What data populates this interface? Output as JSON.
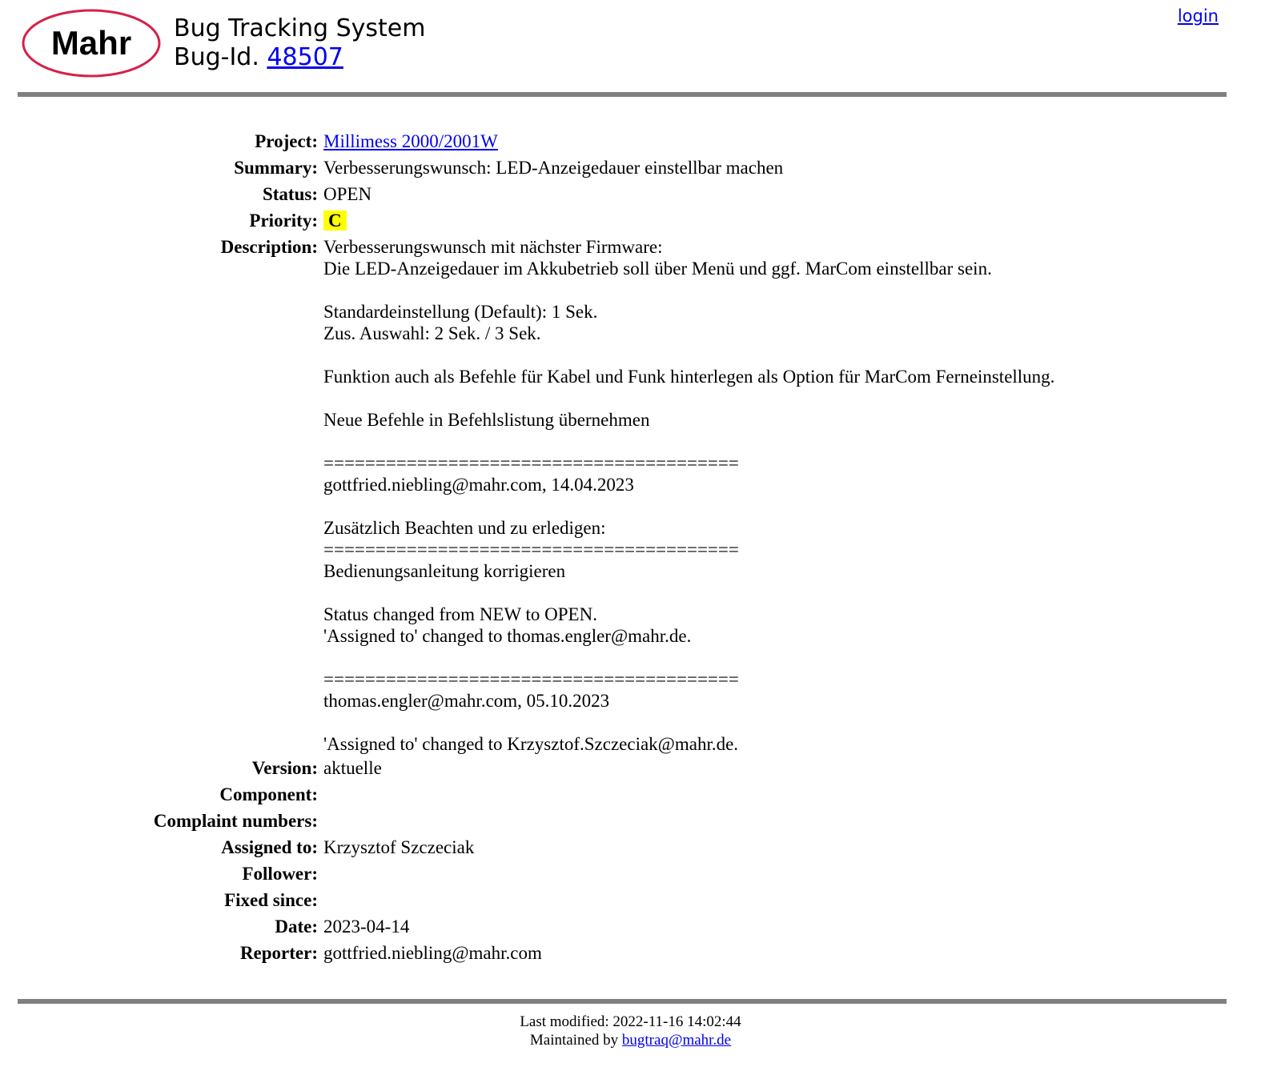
{
  "header": {
    "logo_text": "Mahr",
    "title": "Bug Tracking System",
    "bug_id_prefix": "Bug-Id.",
    "bug_id": "48507",
    "login": "login"
  },
  "fields": {
    "project": {
      "label": "Project:",
      "value": "Millimess 2000/2001W"
    },
    "summary": {
      "label": "Summary:",
      "value": "Verbesserungswunsch: LED-Anzeigedauer einstellbar machen"
    },
    "status": {
      "label": "Status:",
      "value": "OPEN"
    },
    "priority": {
      "label": "Priority:",
      "value": "C"
    },
    "description": {
      "label": "Description:",
      "value": "Verbesserungswunsch mit nächster Firmware:\nDie LED-Anzeigedauer im Akkubetrieb soll über Menü und ggf. MarCom einstellbar sein.\n\nStandardeinstellung (Default): 1 Sek.\nZus. Auswahl: 2 Sek. / 3 Sek.\n\nFunktion auch als Befehle für Kabel und Funk hinterlegen als Option für MarCom Ferneinstellung.\n\nNeue Befehle in Befehlslistung übernehmen\n\n========================================\ngottfried.niebling@mahr.com, 14.04.2023\n\nZusätzlich Beachten und zu erledigen:\n========================================\nBedienungsanleitung korrigieren\n\nStatus changed from NEW to OPEN.\n'Assigned to' changed to thomas.engler@mahr.de.\n\n========================================\nthomas.engler@mahr.com, 05.10.2023\n\n'Assigned to' changed to Krzysztof.Szczeciak@mahr.de."
    },
    "version": {
      "label": "Version:",
      "value": "aktuelle"
    },
    "component": {
      "label": "Component:",
      "value": ""
    },
    "complaint_numbers": {
      "label": "Complaint numbers:",
      "value": ""
    },
    "assigned_to": {
      "label": "Assigned to:",
      "value": "Krzysztof Szczeciak"
    },
    "follower": {
      "label": "Follower:",
      "value": ""
    },
    "fixed_since": {
      "label": "Fixed since:",
      "value": ""
    },
    "date": {
      "label": "Date:",
      "value": "2023-04-14"
    },
    "reporter": {
      "label": "Reporter:",
      "value": "gottfried.niebling@mahr.com"
    }
  },
  "footer": {
    "last_modified": "Last modified: 2022-11-16 14:02:44",
    "maintained_by_prefix": "Maintained by",
    "maintainer_email": "bugtraq@mahr.de"
  },
  "colors": {
    "logo_ring": "#d6204a",
    "rule": "#808080",
    "priority_highlight": "#ffff00",
    "link": "#0000ee"
  }
}
